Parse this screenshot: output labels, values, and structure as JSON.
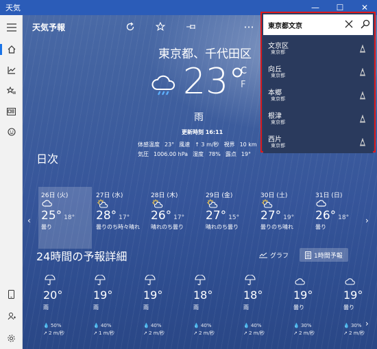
{
  "window": {
    "title": "天気",
    "minimize": "—",
    "maximize": "☐",
    "close": "✕"
  },
  "rail": {
    "menu_icon": "hamburger-menu-icon",
    "items": [
      "home-icon",
      "historical-weather-icon",
      "favorites-icon",
      "news-icon",
      "feedback-icon"
    ],
    "bottom": [
      "phone-icon",
      "account-icon",
      "settings-icon"
    ]
  },
  "toolbar": {
    "app_name": "天気予報",
    "more": "···"
  },
  "current": {
    "location": "東京都、千代田区",
    "temperature": "23°",
    "unit_c": "C",
    "unit_f": "F",
    "condition": "雨",
    "updated": "更新時刻 16:11",
    "details": [
      [
        "体感温度",
        "23°",
        "風速",
        "↑ 3 m/秒",
        "視界",
        "10 km"
      ],
      [
        "気圧",
        "1006.00 hPa",
        "湿度",
        "78%",
        "露点",
        "19°"
      ]
    ]
  },
  "daily": {
    "heading": "日次",
    "days": [
      {
        "date": "26日 (火)",
        "hi": "25°",
        "lo": "18°",
        "cond": "曇り",
        "icon": "cloud"
      },
      {
        "date": "27日 (水)",
        "hi": "28°",
        "lo": "17°",
        "cond": "曇りのち時々晴れ",
        "icon": "partly-sunny"
      },
      {
        "date": "28日 (木)",
        "hi": "26°",
        "lo": "17°",
        "cond": "晴れのち曇り",
        "icon": "partly-sunny"
      },
      {
        "date": "29日 (金)",
        "hi": "27°",
        "lo": "15°",
        "cond": "晴れのち曇り",
        "icon": "partly-sunny"
      },
      {
        "date": "30日 (土)",
        "hi": "27°",
        "lo": "19°",
        "cond": "曇りのち晴れ",
        "icon": "partly-sunny"
      },
      {
        "date": "31日 (日)",
        "hi": "26°",
        "lo": "18°",
        "cond": "曇り",
        "icon": "cloud"
      }
    ],
    "prev": "‹",
    "next": "›"
  },
  "hourly": {
    "heading": "24時間の予報詳細",
    "graph_label": "グラフ",
    "hourly_label": "1時間予報",
    "hours": [
      {
        "temp": "20°",
        "cond": "雨",
        "precip": "50%",
        "wind": "2 m/秒",
        "icon": "umbrella"
      },
      {
        "temp": "19°",
        "cond": "雨",
        "precip": "40%",
        "wind": "1 m/秒",
        "icon": "umbrella"
      },
      {
        "temp": "19°",
        "cond": "雨",
        "precip": "40%",
        "wind": "2 m/秒",
        "icon": "umbrella"
      },
      {
        "temp": "18°",
        "cond": "雨",
        "precip": "40%",
        "wind": "2 m/秒",
        "icon": "umbrella"
      },
      {
        "temp": "18°",
        "cond": "雨",
        "precip": "40%",
        "wind": "2 m/秒",
        "icon": "umbrella"
      },
      {
        "temp": "19°",
        "cond": "曇り",
        "precip": "30%",
        "wind": "2 m/秒",
        "icon": "cloud"
      },
      {
        "temp": "19°",
        "cond": "曇り",
        "precip": "30%",
        "wind": "2 m/秒",
        "icon": "cloud"
      }
    ],
    "next": "›"
  },
  "search": {
    "value": "東京都文京",
    "suggestions": [
      {
        "name": "文京区",
        "sub": "東京都"
      },
      {
        "name": "向丘",
        "sub": "東京都"
      },
      {
        "name": "本郷",
        "sub": "東京都"
      },
      {
        "name": "根津",
        "sub": "東京都"
      },
      {
        "name": "西片",
        "sub": "東京都"
      }
    ]
  }
}
